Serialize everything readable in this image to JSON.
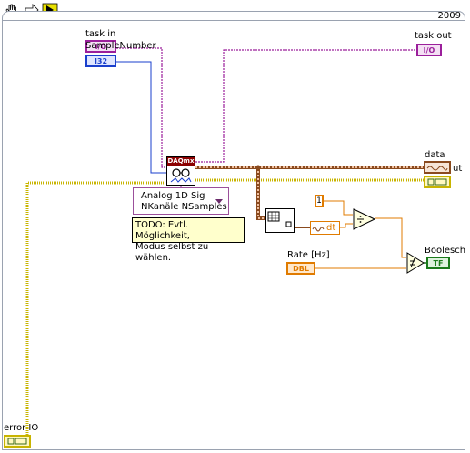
{
  "version_label": "2009",
  "toolbar": {
    "icons": [
      "hand-icon",
      "arrow-icon",
      "run-icon"
    ]
  },
  "controls": {
    "task_in": "task in",
    "sample_number": "SampleNumber",
    "sample_number_type": "I32",
    "rate": "Rate [Hz]",
    "rate_type": "DBL",
    "error_in": "error IO"
  },
  "indicators": {
    "task_out": "task out",
    "task_out_type": "I/O",
    "data": "data",
    "data_suffix": "ut",
    "boolean": "Boolesch",
    "boolean_type": "TF"
  },
  "daqmx": {
    "header": "DAQmx"
  },
  "polymorphic": {
    "line1": "Analog 1D Sig",
    "line2": "NKanäle NSamples"
  },
  "comment": {
    "line1": "TODO: Evtl. Möglichkeit,",
    "line2": "Modus selbst zu wählen."
  },
  "constant": {
    "value": "1"
  },
  "dt_label": "dt",
  "colors": {
    "task": "#9b1f9b",
    "error": "#c8b400",
    "dbl": "#e07b00",
    "bool": "#1a7a1a",
    "i32": "#1a3fcc",
    "waveform": "#8a4a1e"
  }
}
